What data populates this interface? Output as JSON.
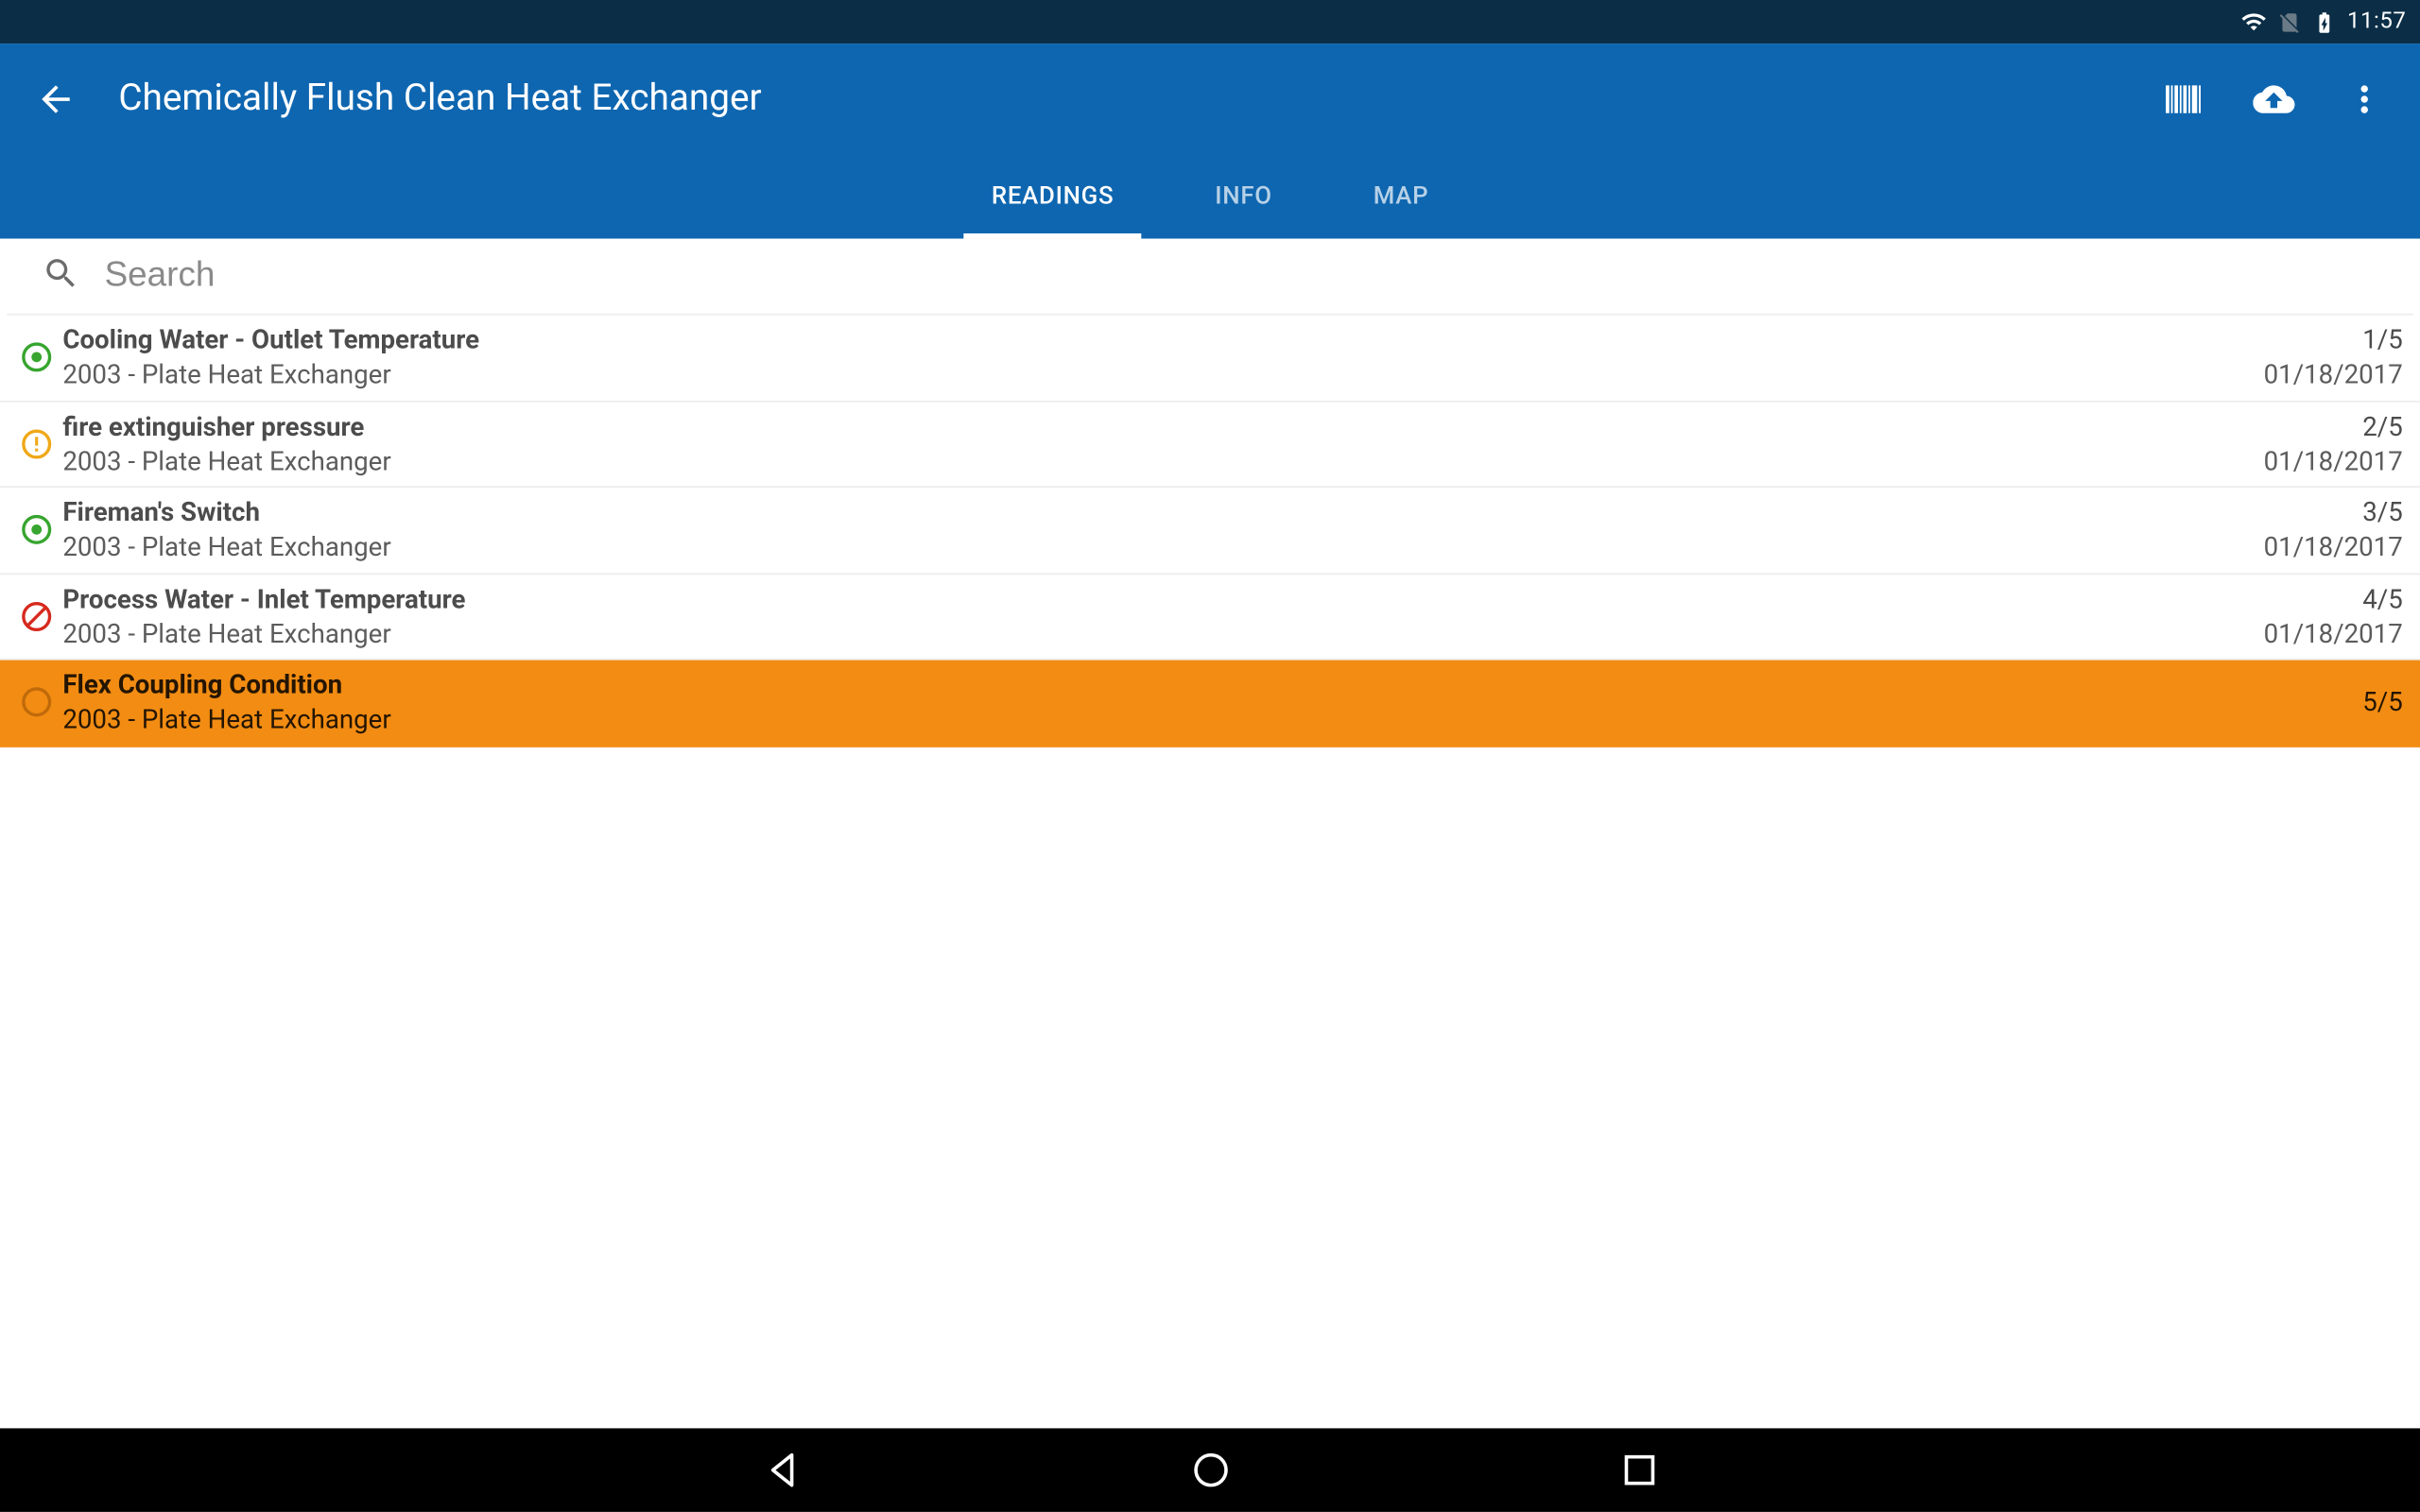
{
  "statusbar": {
    "clock": "11:57"
  },
  "appbar": {
    "title": "Chemically Flush Clean Heat Exchanger"
  },
  "tabs": [
    {
      "label": "READINGS",
      "active": true
    },
    {
      "label": "INFO",
      "active": false
    },
    {
      "label": "MAP",
      "active": false
    }
  ],
  "search": {
    "placeholder": "Search"
  },
  "readings": [
    {
      "status": "ok",
      "title": "Cooling Water - Outlet Temperature",
      "sub": "2003 - Plate Heat Exchanger",
      "count": "1/5",
      "date": "01/18/2017",
      "selected": false
    },
    {
      "status": "warn",
      "title": "fire extinguisher pressure",
      "sub": "2003 - Plate Heat Exchanger",
      "count": "2/5",
      "date": "01/18/2017",
      "selected": false
    },
    {
      "status": "ok",
      "title": "Fireman's Switch",
      "sub": "2003 - Plate Heat Exchanger",
      "count": "3/5",
      "date": "01/18/2017",
      "selected": false
    },
    {
      "status": "blocked",
      "title": "Process Water - Inlet Temperature",
      "sub": "2003 - Plate Heat Exchanger",
      "count": "4/5",
      "date": "01/18/2017",
      "selected": false
    },
    {
      "status": "pending",
      "title": "Flex Coupling Condition",
      "sub": "2003 - Plate Heat Exchanger",
      "count": "5/5",
      "date": "",
      "selected": true
    }
  ]
}
